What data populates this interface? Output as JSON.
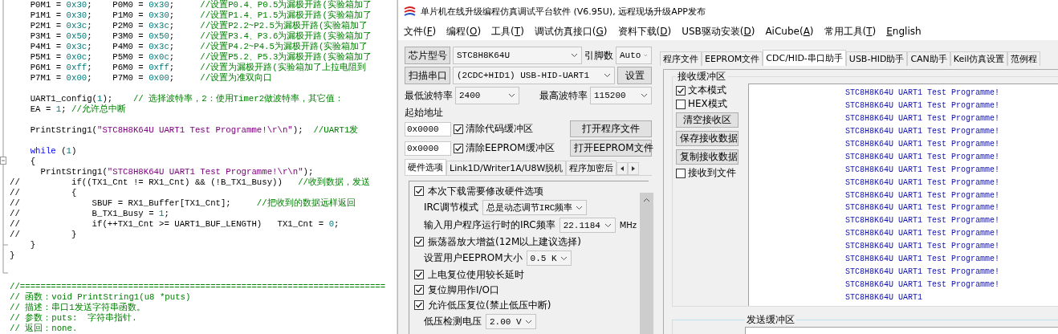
{
  "editor": {
    "lines": [
      {
        "kind": "code",
        "segments": [
          {
            "kind": "code",
            "text": "    P0M1 = "
          },
          {
            "kind": "num",
            "text": "0x30"
          },
          {
            "kind": "code",
            "text": ";    P0M0 = "
          },
          {
            "kind": "num",
            "text": "0x30"
          },
          {
            "kind": "code",
            "text": ";     "
          },
          {
            "kind": "cmt",
            "text": "//设置P0.4、P0.5为漏极开路(实验箱加了"
          }
        ]
      },
      {
        "kind": "code",
        "segments": [
          {
            "kind": "code",
            "text": "    P1M1 = "
          },
          {
            "kind": "num",
            "text": "0x30"
          },
          {
            "kind": "code",
            "text": ";    P1M0 = "
          },
          {
            "kind": "num",
            "text": "0x30"
          },
          {
            "kind": "code",
            "text": ";     "
          },
          {
            "kind": "cmt",
            "text": "//设置P1.4、P1.5为漏极开路(实验箱加了"
          }
        ]
      },
      {
        "kind": "code",
        "segments": [
          {
            "kind": "code",
            "text": "    P2M1 = "
          },
          {
            "kind": "num",
            "text": "0x3c"
          },
          {
            "kind": "code",
            "text": ";    P2M0 = "
          },
          {
            "kind": "num",
            "text": "0x3c"
          },
          {
            "kind": "code",
            "text": ";     "
          },
          {
            "kind": "cmt",
            "text": "//设置P2.2~P2.5为漏极开路(实验箱加了"
          }
        ]
      },
      {
        "kind": "code",
        "segments": [
          {
            "kind": "code",
            "text": "    P3M1 = "
          },
          {
            "kind": "num",
            "text": "0x50"
          },
          {
            "kind": "code",
            "text": ";    P3M0 = "
          },
          {
            "kind": "num",
            "text": "0x50"
          },
          {
            "kind": "code",
            "text": ";     "
          },
          {
            "kind": "cmt",
            "text": "//设置P3.4、P3.6为漏极开路(实验箱加了"
          }
        ]
      },
      {
        "kind": "code",
        "segments": [
          {
            "kind": "code",
            "text": "    P4M1 = "
          },
          {
            "kind": "num",
            "text": "0x3c"
          },
          {
            "kind": "code",
            "text": ";    P4M0 = "
          },
          {
            "kind": "num",
            "text": "0x3c"
          },
          {
            "kind": "code",
            "text": ";     "
          },
          {
            "kind": "cmt",
            "text": "//设置P4.2~P4.5为漏极开路(实验箱加了"
          }
        ]
      },
      {
        "kind": "code",
        "segments": [
          {
            "kind": "code",
            "text": "    P5M1 = "
          },
          {
            "kind": "num",
            "text": "0x0c"
          },
          {
            "kind": "code",
            "text": ";    P5M0 = "
          },
          {
            "kind": "num",
            "text": "0x0c"
          },
          {
            "kind": "code",
            "text": ";     "
          },
          {
            "kind": "cmt",
            "text": "//设置P5.2、P5.3为漏极开路(实验箱加了"
          }
        ]
      },
      {
        "kind": "code",
        "segments": [
          {
            "kind": "code",
            "text": "    P6M1 = "
          },
          {
            "kind": "num",
            "text": "0xff"
          },
          {
            "kind": "code",
            "text": ";    P6M0 = "
          },
          {
            "kind": "num",
            "text": "0xff"
          },
          {
            "kind": "code",
            "text": ";     "
          },
          {
            "kind": "cmt",
            "text": "//设置为漏极开路(实验箱加了上拉电阻到"
          }
        ]
      },
      {
        "kind": "code",
        "segments": [
          {
            "kind": "code",
            "text": "    P7M1 = "
          },
          {
            "kind": "num",
            "text": "0x00"
          },
          {
            "kind": "code",
            "text": ";    P7M0 = "
          },
          {
            "kind": "num",
            "text": "0x00"
          },
          {
            "kind": "code",
            "text": ";     "
          },
          {
            "kind": "cmt",
            "text": "//设置为准双向口"
          }
        ]
      },
      {
        "kind": "blank"
      },
      {
        "kind": "code",
        "segments": [
          {
            "kind": "code",
            "text": "    UART1_config("
          },
          {
            "kind": "num",
            "text": "1"
          },
          {
            "kind": "code",
            "text": ");    "
          },
          {
            "kind": "cmt",
            "text": "// 选择波特率，2：使用Timer2做波特率，其它值："
          }
        ]
      },
      {
        "kind": "code",
        "segments": [
          {
            "kind": "code",
            "text": "    EA = "
          },
          {
            "kind": "num",
            "text": "1"
          },
          {
            "kind": "code",
            "text": "; "
          },
          {
            "kind": "cmt",
            "text": "//允许总中断"
          }
        ]
      },
      {
        "kind": "blank"
      },
      {
        "kind": "code",
        "segments": [
          {
            "kind": "code",
            "text": "    PrintString1("
          },
          {
            "kind": "str",
            "text": "\"STC8H8K64U UART1 Test Programme!\\r\\n\""
          },
          {
            "kind": "code",
            "text": ");  "
          },
          {
            "kind": "cmt",
            "text": "//UART1发"
          }
        ]
      },
      {
        "kind": "blank"
      },
      {
        "kind": "code",
        "segments": [
          {
            "kind": "kw",
            "text": "    while"
          },
          {
            "kind": "code",
            "text": " ("
          },
          {
            "kind": "num",
            "text": "1"
          },
          {
            "kind": "code",
            "text": ")"
          }
        ]
      },
      {
        "kind": "code",
        "segments": [
          {
            "kind": "code",
            "text": "    {"
          }
        ]
      },
      {
        "kind": "code",
        "segments": [
          {
            "kind": "code",
            "text": "      PrintString1("
          },
          {
            "kind": "str",
            "text": "\"STC8H8K64U UART1 Test Programme!\\r\\n\""
          },
          {
            "kind": "code",
            "text": ");"
          }
        ]
      },
      {
        "kind": "code",
        "segments": [
          {
            "kind": "code",
            "text": "//          if((TX1_Cnt != RX1_Cnt) && (!B_TX1_Busy))   "
          },
          {
            "kind": "cmt",
            "text": "//收到数据，发送"
          }
        ]
      },
      {
        "kind": "code",
        "segments": [
          {
            "kind": "code",
            "text": "//          {"
          }
        ]
      },
      {
        "kind": "code",
        "segments": [
          {
            "kind": "code",
            "text": "//              SBUF = RX1_Buffer[TX1_Cnt];     "
          },
          {
            "kind": "cmt",
            "text": "//把收到的数据远样返回"
          }
        ]
      },
      {
        "kind": "code",
        "segments": [
          {
            "kind": "code",
            "text": "//              B_TX1_Busy = "
          },
          {
            "kind": "num",
            "text": "1"
          },
          {
            "kind": "code",
            "text": ";"
          }
        ]
      },
      {
        "kind": "code",
        "segments": [
          {
            "kind": "code",
            "text": "//              if(++TX1_Cnt >= UART1_BUF_LENGTH)   TX1_Cnt = "
          },
          {
            "kind": "num",
            "text": "0"
          },
          {
            "kind": "code",
            "text": ";"
          }
        ]
      },
      {
        "kind": "code",
        "segments": [
          {
            "kind": "code",
            "text": "//          }"
          }
        ]
      },
      {
        "kind": "code",
        "segments": [
          {
            "kind": "code",
            "text": "    }"
          }
        ]
      },
      {
        "kind": "code",
        "segments": [
          {
            "kind": "code",
            "text": "}"
          }
        ]
      },
      {
        "kind": "blank"
      },
      {
        "kind": "blank"
      },
      {
        "kind": "code",
        "segments": [
          {
            "kind": "cmt",
            "text": "//======================================================================="
          }
        ]
      },
      {
        "kind": "code",
        "segments": [
          {
            "kind": "cmt",
            "text": "// 函数：void PrintString1(u8 *puts)"
          }
        ]
      },
      {
        "kind": "code",
        "segments": [
          {
            "kind": "cmt",
            "text": "// 描述：串口1发送字符串函数。"
          }
        ]
      },
      {
        "kind": "code",
        "segments": [
          {
            "kind": "cmt",
            "text": "// 参数：puts:  字符串指针."
          }
        ]
      },
      {
        "kind": "code",
        "segments": [
          {
            "kind": "cmt",
            "text": "// 返回：none."
          }
        ]
      }
    ]
  },
  "window": {
    "title": "单片机在线升级编程仿真调试平台软件 (V6.95U), 远程现场升级APP发布"
  },
  "menu": [
    {
      "before": "文件(",
      "key": "F",
      "after": ")"
    },
    {
      "before": "编程(",
      "key": "O",
      "after": ")"
    },
    {
      "before": "工具(",
      "key": "T",
      "after": ")"
    },
    {
      "before": "调试仿真接口(",
      "key": "G",
      "after": ")"
    },
    {
      "before": "资料下载(",
      "key": "D",
      "after": ")"
    },
    {
      "before": "USB驱动安装(",
      "key": "D",
      "after": ")"
    },
    {
      "before": "AiCube(",
      "key": "A",
      "after": ")"
    },
    {
      "before": "常用工具(",
      "key": "T",
      "after": ")"
    },
    {
      "key": "E",
      "after": "nglish"
    }
  ],
  "left_panel": {
    "chip_button": "芯片型号",
    "chip_select": "STC8H8K64U",
    "pins_label": "引脚数",
    "pins_select": "Auto",
    "scan_button": "扫描串口",
    "port_select": "(2CDC+HID1) USB-HID-UART1",
    "settings_button": "设置",
    "min_baud_label": "最低波特率",
    "min_baud_select": "2400",
    "max_baud_label": "最高波特率",
    "max_baud_select": "115200",
    "start_address_label": "起始地址",
    "address_rows": [
      {
        "address": "0x0000",
        "checkbox_label": "清除代码缓冲区",
        "checked": true,
        "button": "打开程序文件"
      },
      {
        "address": "0x0000",
        "checkbox_label": "清除EEPROM缓冲区",
        "checked": true,
        "button": "打开EEPROM文件"
      }
    ],
    "tabs": [
      {
        "label": "硬件选项",
        "selected": true
      },
      {
        "label": "Link1D/Writer1A/U8W脱机",
        "selected": false
      },
      {
        "label": "程序加密后",
        "selected": false
      }
    ],
    "options": [
      {
        "kind": "checkbox",
        "label": "本次下载需要修改硬件选项",
        "checked": true
      },
      {
        "kind": "select",
        "label": "IRC调节模式",
        "value": "总是动态调节IRC频率"
      },
      {
        "kind": "select",
        "label": "输入用户程序运行时的IRC频率",
        "value": "22.1184",
        "unit": "MHz"
      },
      {
        "kind": "checkbox",
        "label": "振荡器放大增益(12M以上建议选择)",
        "checked": true
      },
      {
        "kind": "select",
        "label": "设置用户EEPROM大小",
        "value": "0.5 K"
      },
      {
        "kind": "checkbox",
        "label": "上电复位使用较长延时",
        "checked": true
      },
      {
        "kind": "checkbox",
        "label": "复位脚用作I/O口",
        "checked": true
      },
      {
        "kind": "checkbox",
        "label": "允许低压复位(禁止低压中断)",
        "checked": true
      },
      {
        "kind": "select",
        "label": "低压检测电压",
        "value": "2.00 V"
      }
    ]
  },
  "right_panel": {
    "tabs": [
      {
        "label": "程序文件",
        "selected": false
      },
      {
        "label": "EEPROM文件",
        "selected": false
      },
      {
        "label": "CDC/HID-串口助手",
        "selected": true
      },
      {
        "label": "USB-HID助手",
        "selected": false
      },
      {
        "label": "CAN助手",
        "selected": false
      },
      {
        "label": "Keil仿真设置",
        "selected": false
      },
      {
        "label": "范例程",
        "selected": false
      }
    ],
    "receive": {
      "title": "接收缓冲区",
      "modes": [
        {
          "label": "文本模式",
          "checked": true
        },
        {
          "label": "HEX模式",
          "checked": false
        }
      ],
      "buttons": [
        "清空接收区",
        "保存接收数据",
        "复制接收数据"
      ],
      "to_file": {
        "label": "接收到文件",
        "checked": false
      },
      "lines": [
        "STC8H8K64U UART1 Test Programme!",
        "STC8H8K64U UART1 Test Programme!",
        "STC8H8K64U UART1 Test Programme!",
        "STC8H8K64U UART1 Test Programme!",
        "STC8H8K64U UART1 Test Programme!",
        "STC8H8K64U UART1 Test Programme!",
        "STC8H8K64U UART1 Test Programme!",
        "STC8H8K64U UART1 Test Programme!",
        "STC8H8K64U UART1 Test Programme!",
        "STC8H8K64U UART1 Test Programme!",
        "STC8H8K64U UART1 Test Programme!",
        "STC8H8K64U UART1 Test Programme!",
        "STC8H8K64U UART1 Test Programme!",
        "STC8H8K64U UART1 Test Programme!",
        "STC8H8K64U UART1 Test Programme!",
        "STC8H8K64U UART1 Test Programme!",
        "STC8H8K64U UART1"
      ]
    },
    "send": {
      "title": "发送缓冲区"
    }
  }
}
